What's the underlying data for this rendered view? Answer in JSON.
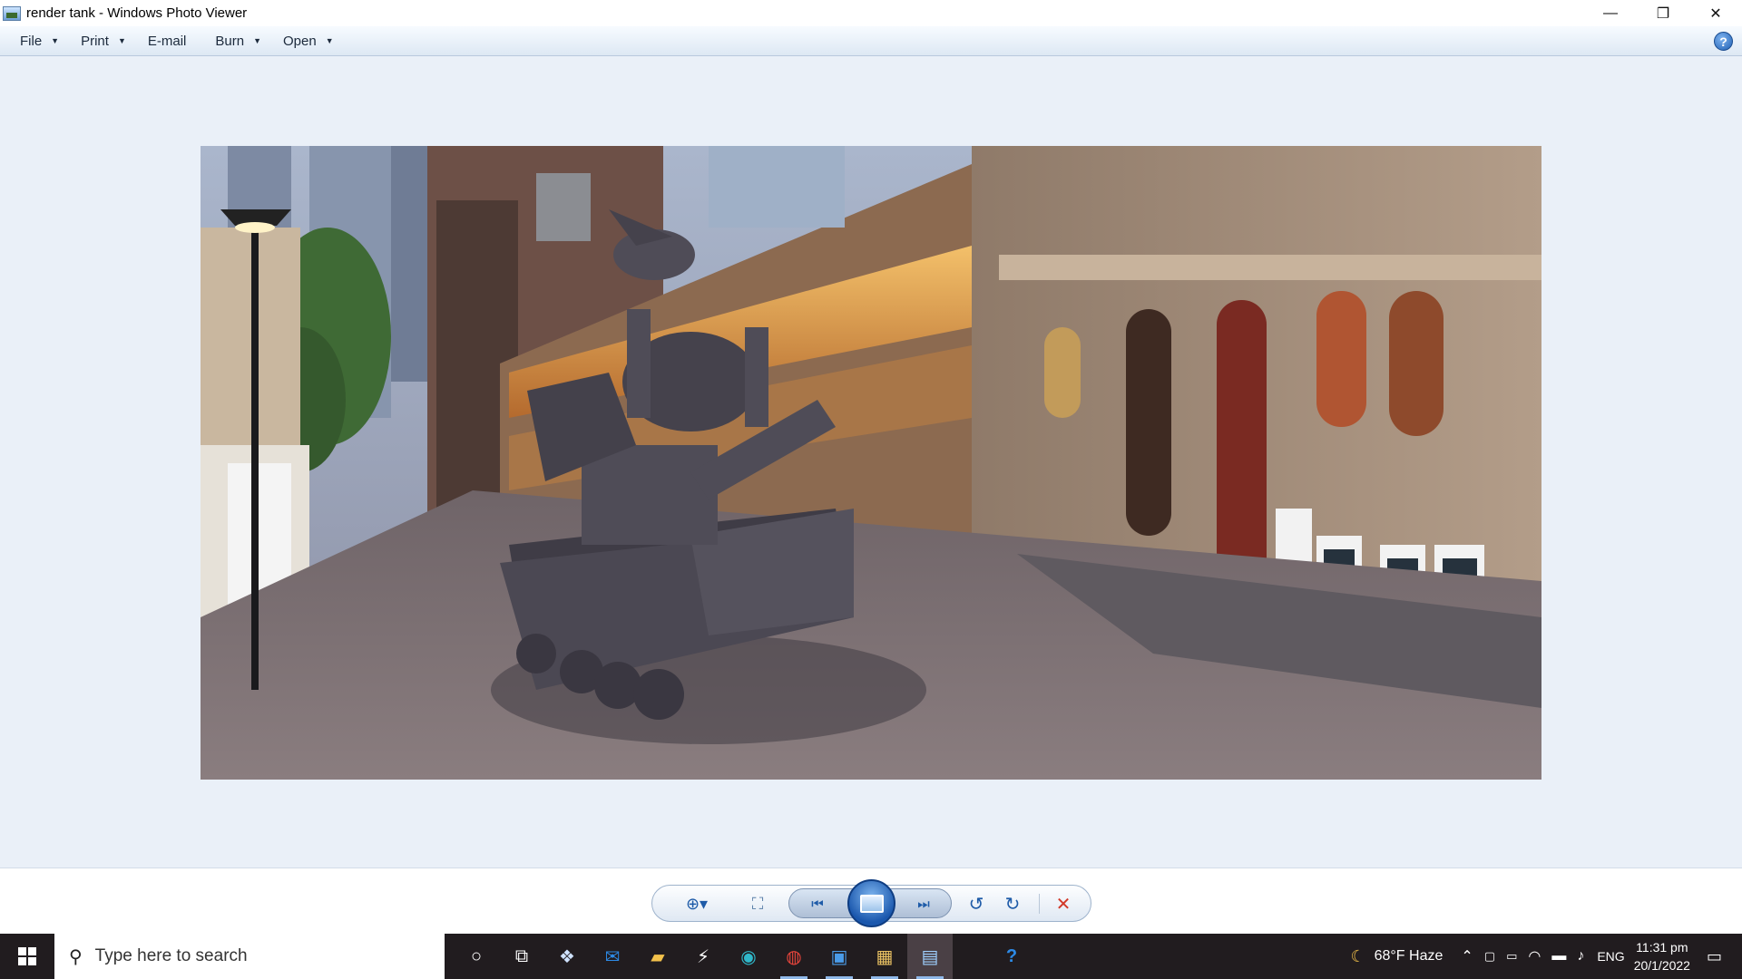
{
  "window": {
    "title": "render tank - Windows Photo Viewer",
    "controls": {
      "minimize": "—",
      "restore": "❐",
      "close": "✕"
    }
  },
  "menu": {
    "items": [
      {
        "label": "File",
        "has_dropdown": true
      },
      {
        "label": "Print",
        "has_dropdown": true
      },
      {
        "label": "E-mail",
        "has_dropdown": false
      },
      {
        "label": "Burn",
        "has_dropdown": true
      },
      {
        "label": "Open",
        "has_dropdown": true
      }
    ],
    "help_label": "?"
  },
  "photo": {
    "subject": "tank-render-on-street",
    "colors": {
      "sky": "#9aa8c0",
      "building_left": "#6d5047",
      "building_right": "#a8907c",
      "tank": "#4b4853",
      "street": "#7a6c6e"
    }
  },
  "controls": {
    "zoom": "zoom-icon",
    "actual_size": "fit-to-window-icon",
    "previous": "previous-icon",
    "slideshow": "slideshow-icon",
    "next": "next-icon",
    "rotate_ccw": "rotate-counterclockwise-icon",
    "rotate_cw": "rotate-clockwise-icon",
    "delete": "delete-icon"
  },
  "taskbar": {
    "search_placeholder": "Type here to search",
    "apps": [
      "cortana-icon",
      "task-view-icon",
      "dropbox-icon",
      "mail-icon",
      "file-explorer-icon",
      "app-bolt-icon",
      "edge-icon",
      "chrome-icon",
      "photos-icon",
      "media-app-icon",
      "photo-viewer-icon",
      "help-app-icon"
    ],
    "weather": "68°F  Haze",
    "language": "ENG",
    "time": "11:31 pm",
    "date": "20/1/2022"
  },
  "accent": "#1e5ba8"
}
